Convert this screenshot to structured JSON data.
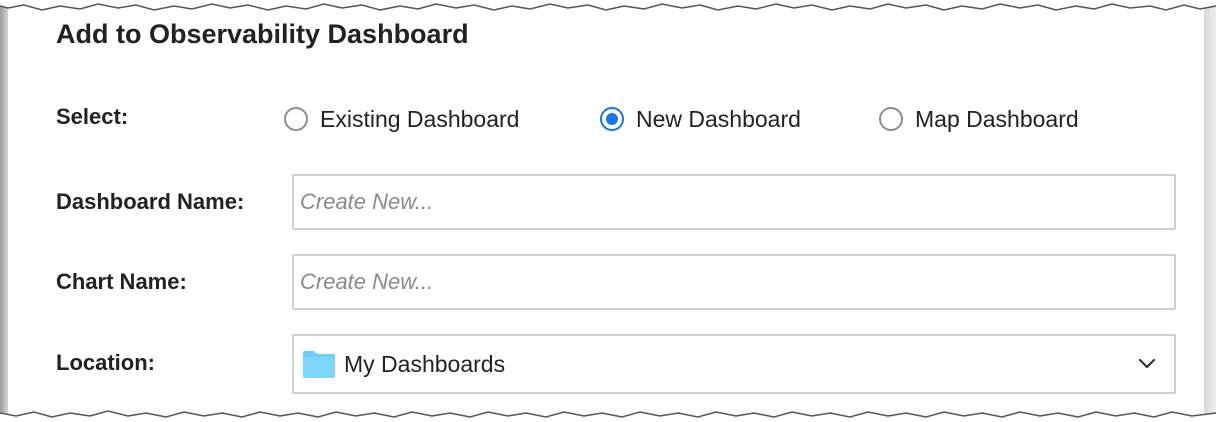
{
  "dialog": {
    "title": "Add to Observability Dashboard"
  },
  "select_row": {
    "label": "Select:",
    "options": [
      {
        "label": "Existing Dashboard",
        "checked": false
      },
      {
        "label": "New Dashboard",
        "checked": true
      },
      {
        "label": "Map Dashboard",
        "checked": false
      }
    ]
  },
  "dashboard_name": {
    "label": "Dashboard Name:",
    "placeholder": "Create New...",
    "value": ""
  },
  "chart_name": {
    "label": "Chart Name:",
    "placeholder": "Create New...",
    "value": ""
  },
  "location": {
    "label": "Location:",
    "selected": "My Dashboards",
    "icon": "folder-icon"
  },
  "colors": {
    "accent": "#1a73e8",
    "folder": "#6ecff6",
    "border": "#cfcfcf"
  }
}
